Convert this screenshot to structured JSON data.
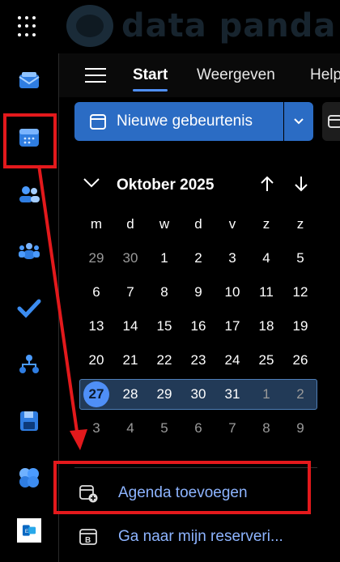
{
  "brand": {
    "logo_text": "data panda"
  },
  "colors": {
    "accent": "#2b6cc4",
    "today": "#4f8ff7",
    "link": "#8db4ff",
    "annotation": "#e3191c"
  },
  "rail": {
    "apps": [
      {
        "name": "mail-icon"
      },
      {
        "name": "calendar-icon"
      },
      {
        "name": "people-icon"
      },
      {
        "name": "teams-icon"
      },
      {
        "name": "todo-icon"
      },
      {
        "name": "org-icon"
      },
      {
        "name": "save-icon"
      },
      {
        "name": "cloud-icon"
      },
      {
        "name": "exchange-icon"
      }
    ]
  },
  "ribbon": {
    "tabs": [
      {
        "label": "Start",
        "active": true
      },
      {
        "label": "Weergeven",
        "active": false
      },
      {
        "label": "Help",
        "active": false
      }
    ]
  },
  "toolbar": {
    "new_event_label": "Nieuwe gebeurtenis"
  },
  "calendar": {
    "month_label": "Oktober 2025",
    "weekdays": [
      "m",
      "d",
      "w",
      "d",
      "v",
      "z",
      "z"
    ],
    "weeks": [
      [
        "29",
        "30",
        "1",
        "2",
        "3",
        "4",
        "5"
      ],
      [
        "6",
        "7",
        "8",
        "9",
        "10",
        "11",
        "12"
      ],
      [
        "13",
        "14",
        "15",
        "16",
        "17",
        "18",
        "19"
      ],
      [
        "20",
        "21",
        "22",
        "23",
        "24",
        "25",
        "26"
      ],
      [
        "27",
        "28",
        "29",
        "30",
        "31",
        "1",
        "2"
      ],
      [
        "3",
        "4",
        "5",
        "6",
        "7",
        "8",
        "9"
      ]
    ],
    "today": "27"
  },
  "actions": {
    "add_calendar": "Agenda toevoegen",
    "bookings": "Ga naar mijn reserveri..."
  }
}
